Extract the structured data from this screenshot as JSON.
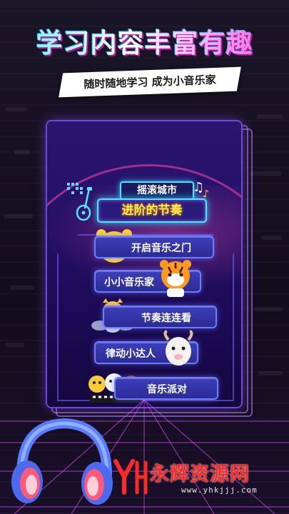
{
  "header": {
    "title": "学习内容丰富有趣",
    "subtitle": "随时随地学习 成为小音乐家"
  },
  "course": {
    "sign_top": "摇滚城市",
    "sign_main": "进阶的节奏",
    "items": [
      {
        "label": "开启音乐之门",
        "mascot": "bear-mascot-icon"
      },
      {
        "label": "小小音乐家",
        "mascot": "tiger-mascot-icon"
      },
      {
        "label": "节奏连连看",
        "mascot": "drummer-mascot-icon"
      },
      {
        "label": "律动小达人",
        "mascot": "goat-mascot-icon"
      },
      {
        "label": "音乐派对",
        "mascot": "band-mascot-icon"
      }
    ]
  },
  "watermark": {
    "brand": "永辉资源网",
    "url": "www.yhkjjj.com"
  },
  "colors": {
    "title_gradient": [
      "#5ff0ff",
      "#ffffff",
      "#ff4fd8"
    ],
    "button_fill": "#2b2c96",
    "sign_text": "#ffe94a",
    "brand_red": "#ff2828"
  }
}
